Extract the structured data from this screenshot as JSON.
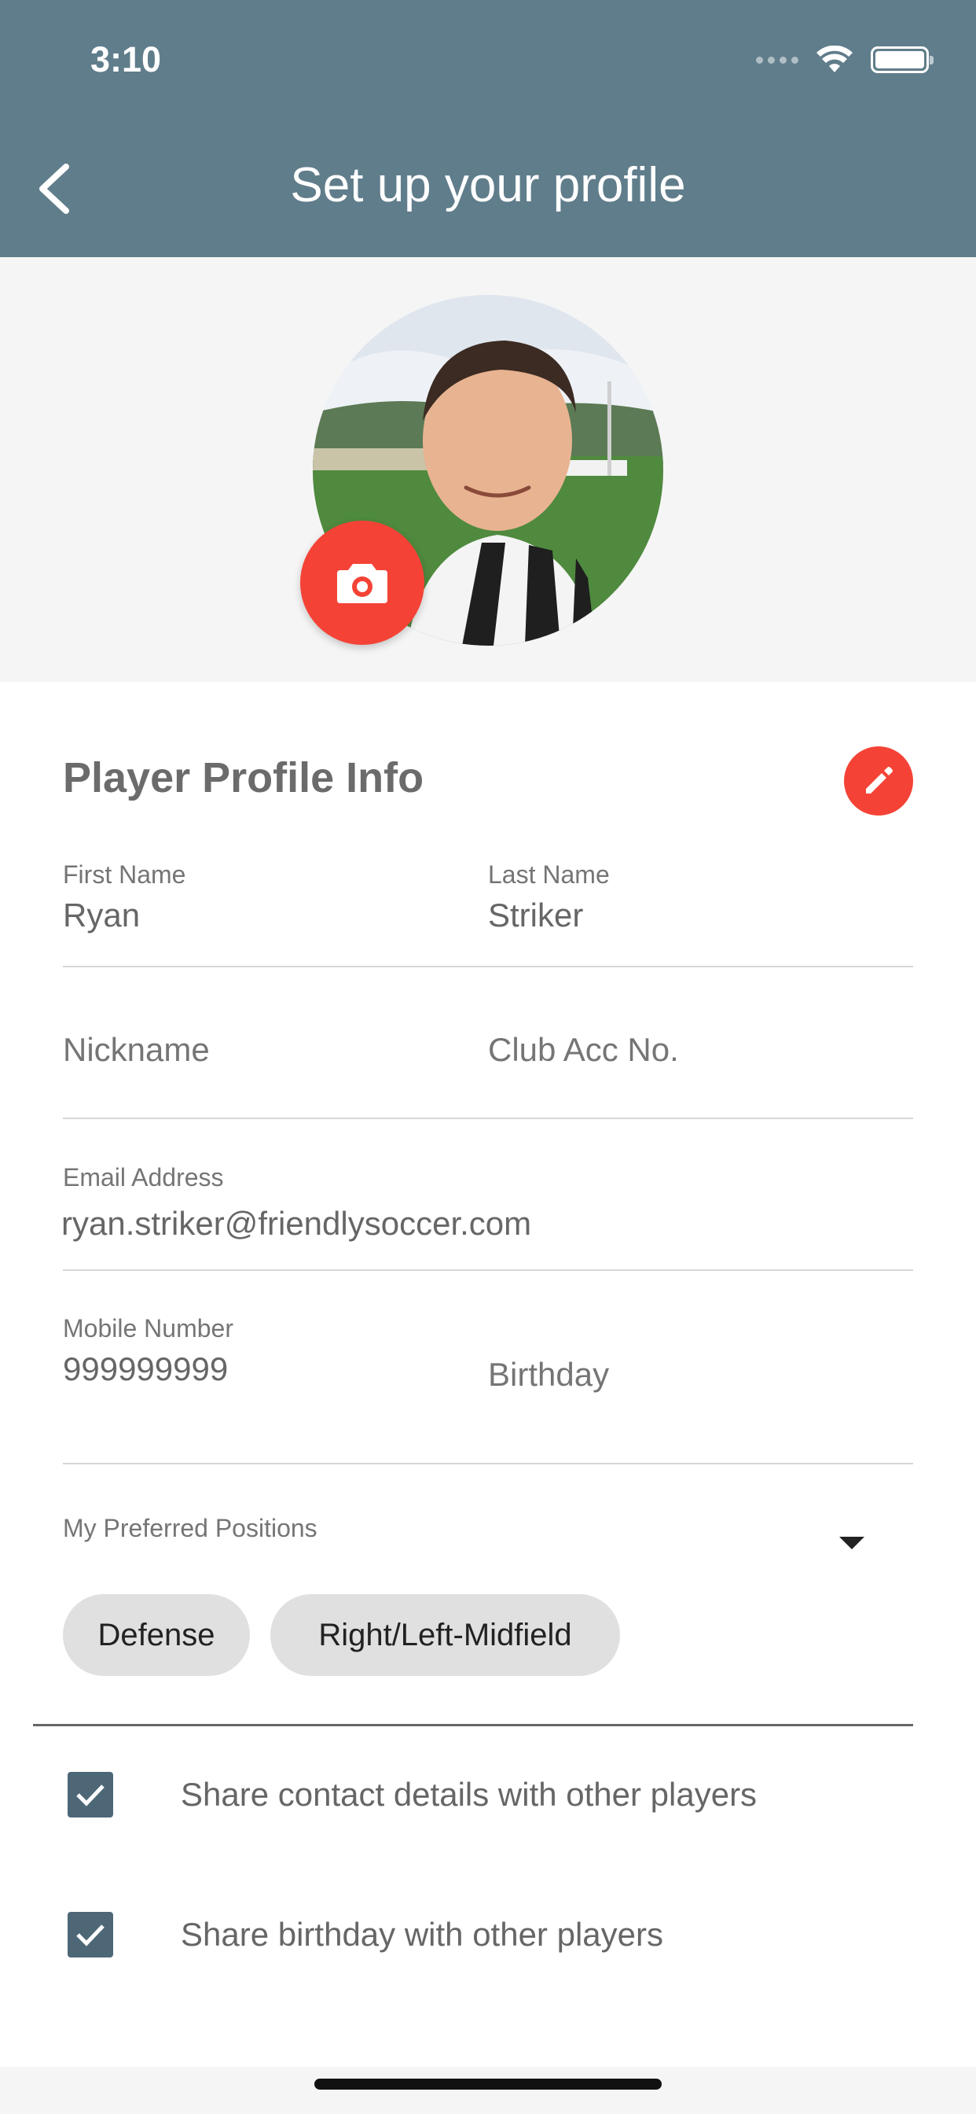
{
  "status_bar": {
    "time": "3:10"
  },
  "header": {
    "title": "Set up your profile"
  },
  "section": {
    "title": "Player Profile Info"
  },
  "fields": {
    "first_name_label": "First Name",
    "first_name_value": "Ryan",
    "last_name_label": "Last Name",
    "last_name_value": "Striker",
    "nickname_placeholder": "Nickname",
    "club_acc_placeholder": "Club Acc No.",
    "email_label": "Email Address",
    "email_value": "ryan.striker@friendlysoccer.com",
    "mobile_label": "Mobile Number",
    "mobile_value": "999999999",
    "birthday_placeholder": "Birthday"
  },
  "positions": {
    "label": "My Preferred Positions",
    "chips": [
      "Defense",
      "Right/Left-Midfield"
    ]
  },
  "sharing": [
    {
      "label": "Share contact details with other players",
      "checked": true
    },
    {
      "label": "Share birthday with other players",
      "checked": true
    }
  ],
  "colors": {
    "header": "#607d8b",
    "accent": "#f44336",
    "checkbox": "#4d6776"
  },
  "icons": [
    "back-arrow-icon",
    "camera-icon",
    "pencil-icon",
    "dropdown-arrow-icon",
    "checkmark-icon",
    "wifi-icon",
    "battery-icon"
  ]
}
